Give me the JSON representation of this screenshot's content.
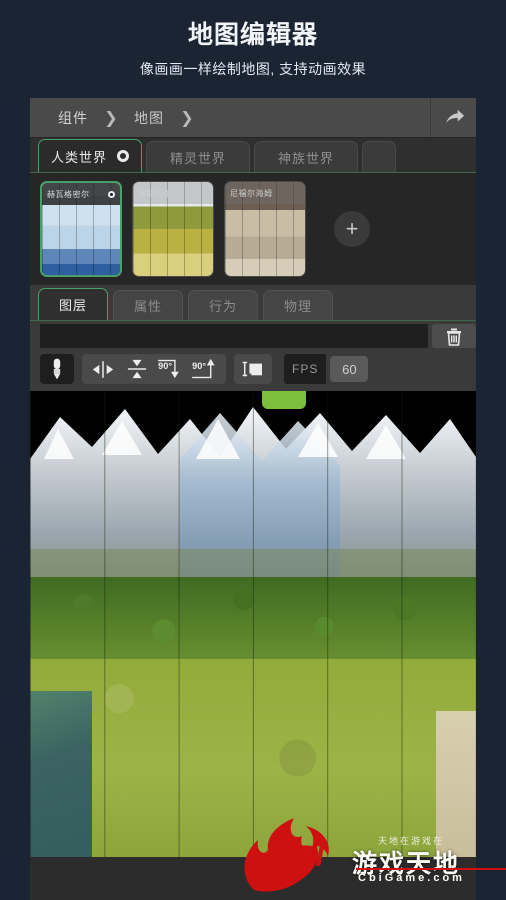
{
  "header": {
    "title": "地图编辑器",
    "subtitle": "像画画一样绘制地图, 支持动画效果"
  },
  "breadcrumb": {
    "items": [
      "组件",
      "地图"
    ],
    "separator": "❯",
    "share_icon": "share-arrow-icon"
  },
  "world_tabs": [
    {
      "label": "人类世界",
      "active": true,
      "icon": "ring-icon"
    },
    {
      "label": "精灵世界",
      "active": false
    },
    {
      "label": "神族世界",
      "active": false
    }
  ],
  "maps": {
    "items": [
      {
        "label": "赫瓦格密尔",
        "selected": true
      },
      {
        "label": "穆斯贝尔",
        "selected": false
      },
      {
        "label": "尼福尔海姆",
        "selected": false
      }
    ],
    "add_label": "+",
    "add_icon": "plus-icon"
  },
  "editor_tabs": [
    {
      "label": "图层",
      "active": true
    },
    {
      "label": "属性",
      "active": false
    },
    {
      "label": "行为",
      "active": false
    },
    {
      "label": "物理",
      "active": false
    }
  ],
  "layer_strip": {
    "field_value": "",
    "delete_icon": "trash-icon"
  },
  "toolbar": {
    "tools": [
      {
        "name": "brush-icon",
        "label": ""
      },
      {
        "name": "flip-horizontal-icon",
        "label": ""
      },
      {
        "name": "flip-vertical-icon",
        "label": ""
      },
      {
        "name": "rotate-cw-icon",
        "label": "90°"
      },
      {
        "name": "rotate-ccw-icon",
        "label": "90°"
      },
      {
        "name": "layer-order-icon",
        "label": ""
      }
    ],
    "fps_label": "FPS",
    "fps_value": "60"
  },
  "canvas": {
    "marker_color": "#7cbf3f",
    "background_color": "#000000"
  },
  "watermark": {
    "brand": "CBI",
    "tagline": "天地在游戏在",
    "name": "游戏天地",
    "url": "CbiGame.com"
  },
  "colors": {
    "page_bg": "#1b2433",
    "panel_bg": "#2c2c2c",
    "accent_green": "#49a06d",
    "watermark_red": "#cf1010"
  }
}
